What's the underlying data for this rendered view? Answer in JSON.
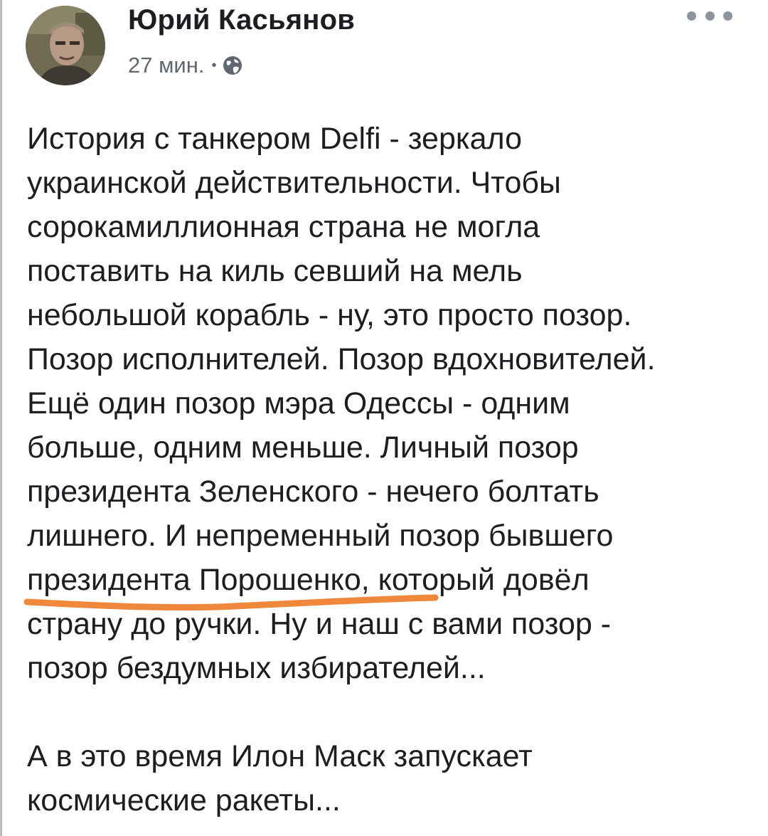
{
  "post": {
    "author": {
      "name": "Юрий Касьянов",
      "avatar_icon": "user-photo"
    },
    "timestamp": "27 мин.",
    "separator": "•",
    "privacy_icon": "globe-icon",
    "more_icon": "more-dots-icon",
    "paragraphs": [
      "История с танкером Delfi - зеркало\nукраинской действительности. Чтобы\nсорокамиллионная страна не могла\nпоставить на киль севший на мель\nнебольшой корабль - ну, это просто позор.\nПозор исполнителей. Позор вдохновителей.\nЕщё один позор мэра Одессы - одним\nбольше, одним меньше. Личный позор\nпрезидента Зеленского - нечего болтать\nлишнего. И непременный позор бывшего\nпрезидента Порошенко, который довёл\nстрану до ручки. Ну и наш с вами позор -\nпозор бездумных избирателей...",
      "А в это время Илон Маск запускает\nкосмические ракеты..."
    ],
    "highlight_color": "#f0883c"
  }
}
